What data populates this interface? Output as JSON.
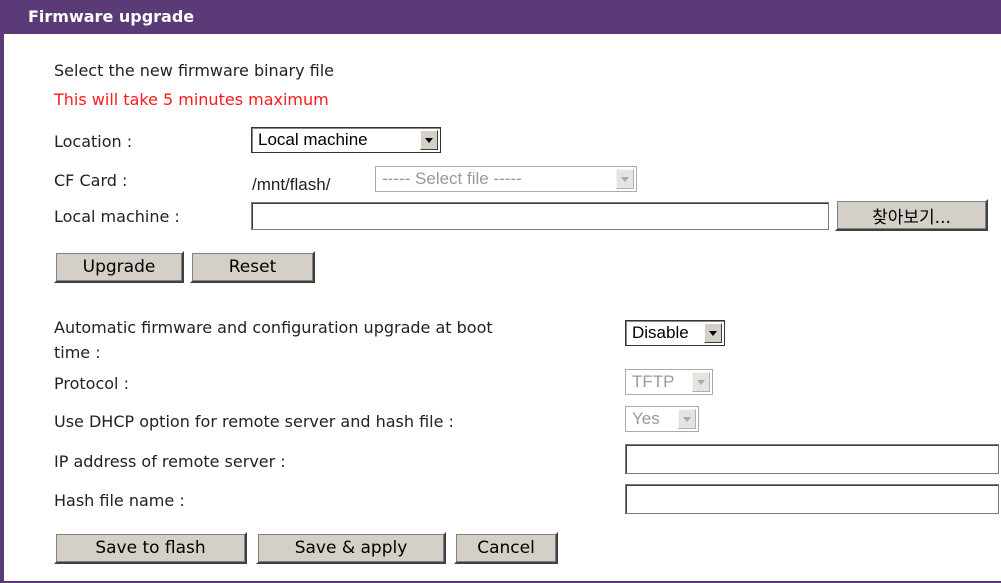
{
  "header": {
    "title": "Firmware upgrade"
  },
  "upload": {
    "intro": "Select the new firmware binary file",
    "warning": "This will take 5 minutes maximum",
    "location_label": "Location :",
    "location_value": "Local machine",
    "cf_label": "CF Card :",
    "cf_path": "/mnt/flash/",
    "cf_select_value": "----- Select file -----",
    "local_label": "Local machine :",
    "local_value": "",
    "browse_label": "찾아보기...",
    "upgrade_label": "Upgrade",
    "reset_label": "Reset"
  },
  "auto": {
    "auto_label_line1": "Automatic firmware and configuration upgrade at boot",
    "auto_label_line2": "time :",
    "auto_value": "Disable",
    "protocol_label": "Protocol :",
    "protocol_value": "TFTP",
    "dhcp_label": "Use DHCP option for remote server and hash file :",
    "dhcp_value": "Yes",
    "ip_label": "IP address of remote server :",
    "ip_value": "",
    "hash_label": "Hash file name :",
    "hash_value": "",
    "save_flash_label": "Save to flash",
    "save_apply_label": "Save & apply",
    "cancel_label": "Cancel"
  }
}
